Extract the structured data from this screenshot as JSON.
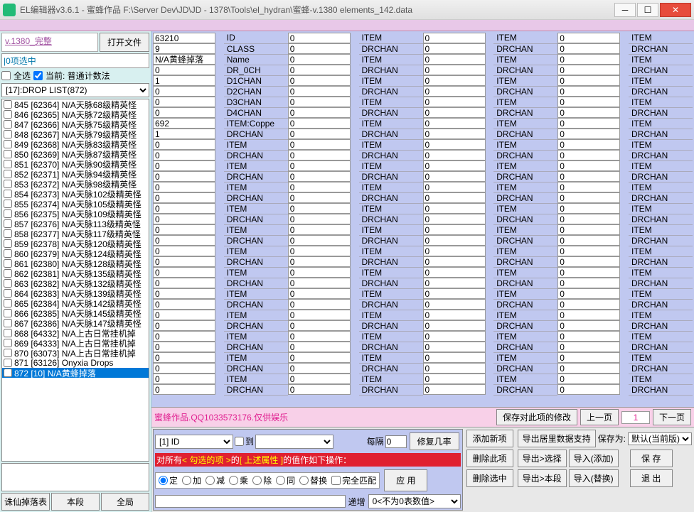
{
  "window": {
    "title": "EL编辑器v3.6.1  -  蜜蜂作品  F:\\Server Dev\\JD\\JD - 1378\\Tools\\el_hydran\\蜜蜂-v.1380 elements_142.data"
  },
  "sidebar": {
    "version_link": "v.1380_完整",
    "open_file": "打开文件",
    "filter_label": "|0项选中",
    "select_all": "全选",
    "current_count": "当前: 普通计数法",
    "droplist": "[17]:DROP LIST(872)",
    "items": [
      {
        "idx": "845",
        "txt": "[62364] N/A天脉68级精英怪"
      },
      {
        "idx": "846",
        "txt": "[62365] N/A天脉72级精英怪"
      },
      {
        "idx": "847",
        "txt": "[62366] N/A天脉75级精英怪"
      },
      {
        "idx": "848",
        "txt": "[62367] N/A天脉79级精英怪"
      },
      {
        "idx": "849",
        "txt": "[62368] N/A天脉83级精英怪"
      },
      {
        "idx": "850",
        "txt": "[62369] N/A天脉87级精英怪"
      },
      {
        "idx": "851",
        "txt": "[62370] N/A天脉90级精英怪"
      },
      {
        "idx": "852",
        "txt": "[62371] N/A天脉94级精英怪"
      },
      {
        "idx": "853",
        "txt": "[62372] N/A天脉98级精英怪"
      },
      {
        "idx": "854",
        "txt": "[62373] N/A天脉102级精英怪"
      },
      {
        "idx": "855",
        "txt": "[62374] N/A天脉105级精英怪"
      },
      {
        "idx": "856",
        "txt": "[62375] N/A天脉109级精英怪"
      },
      {
        "idx": "857",
        "txt": "[62376] N/A天脉113级精英怪"
      },
      {
        "idx": "858",
        "txt": "[62377] N/A天脉117级精英怪"
      },
      {
        "idx": "859",
        "txt": "[62378] N/A天脉120级精英怪"
      },
      {
        "idx": "860",
        "txt": "[62379] N/A天脉124级精英怪"
      },
      {
        "idx": "861",
        "txt": "[62380] N/A天脉128级精英怪"
      },
      {
        "idx": "862",
        "txt": "[62381] N/A天脉135级精英怪"
      },
      {
        "idx": "863",
        "txt": "[62382] N/A天脉132级精英怪"
      },
      {
        "idx": "864",
        "txt": "[62383] N/A天脉139级精英怪"
      },
      {
        "idx": "865",
        "txt": "[62384] N/A天脉142级精英怪"
      },
      {
        "idx": "866",
        "txt": "[62385] N/A天脉145级精英怪"
      },
      {
        "idx": "867",
        "txt": "[62386] N/A天脉147级精英怪"
      },
      {
        "idx": "868",
        "txt": "[64332] N/A上古日常挂机掉"
      },
      {
        "idx": "869",
        "txt": "[64333] N/A上古日常挂机掉"
      },
      {
        "idx": "870",
        "txt": "[63073] N/A上古日常挂机掉"
      },
      {
        "idx": "871",
        "txt": "  [63126] Onyxia Drops"
      },
      {
        "idx": "872",
        "txt": "  [10] N/A黄蜂掉落",
        "selected": true
      }
    ],
    "btn_drop": "诛仙掉落表",
    "btn_section": "本段",
    "btn_all": "全局"
  },
  "grid": {
    "col1_labels": [
      "ID",
      "CLASS",
      "Name",
      "DR_0CH",
      "D1CHAN",
      "D2CHAN",
      "D3CHAN",
      "D4CHAN",
      "ITEM:Coppe",
      "DRCHAN",
      "ITEM",
      "DRCHAN",
      "ITEM",
      "DRCHAN",
      "ITEM",
      "DRCHAN",
      "ITEM",
      "DRCHAN",
      "ITEM",
      "DRCHAN",
      "ITEM",
      "DRCHAN",
      "ITEM",
      "DRCHAN",
      "ITEM",
      "DRCHAN",
      "ITEM",
      "DRCHAN",
      "ITEM",
      "DRCHAN",
      "ITEM",
      "DRCHAN",
      "ITEM",
      "DRCHAN"
    ],
    "col1_values": [
      "63210",
      "9",
      "N/A黄蜂掉落",
      "0",
      "1",
      "0",
      "0",
      "0",
      "692",
      "1",
      "0",
      "0",
      "0",
      "0",
      "0",
      "0",
      "0",
      "0",
      "0",
      "0",
      "0",
      "0",
      "0",
      "0",
      "0",
      "0",
      "0",
      "0",
      "0",
      "0",
      "0",
      "0",
      "0",
      "0"
    ],
    "rest_label_pair": [
      "ITEM",
      "DRCHAN"
    ]
  },
  "status": {
    "left": "蜜蜂作品.QQ1033573176.仅供娱乐",
    "save_changes": "保存对此项的修改",
    "prev": "上一页",
    "page": "1",
    "next": "下一页"
  },
  "ops": {
    "field_sel": "[1] ID",
    "to_label": "到",
    "every_label": "每隔",
    "every_val": "0",
    "fix_rate": "修复几率",
    "hint_pre": "对所有",
    "hint_red": "< 勾选的项 >",
    "hint_mid": "的",
    "hint_yel": "[ 上述属性 ]",
    "hint_post": "的值作如下操作：",
    "r_set": "定",
    "r_add": "加",
    "r_sub": "减",
    "r_mul": "乘",
    "r_div": "除",
    "r_same": "同",
    "r_replace": "替换",
    "r_full": "完全匹配",
    "incr_label": "递增",
    "zero_sel": "0<不为0表数值>",
    "apply": "应 用",
    "add_item": "添加新项",
    "del_item": "删除此项",
    "del_sel": "删除选中",
    "export_support": "导出居里数据支持",
    "save_as": "保存为:",
    "save_mode": "默认(当前版)",
    "export_sel": "导出>选择",
    "import_add": "导入(添加)",
    "export_sec": "导出>本段",
    "import_rep": "导入(替换)",
    "save": "保 存",
    "exit": "退 出"
  }
}
